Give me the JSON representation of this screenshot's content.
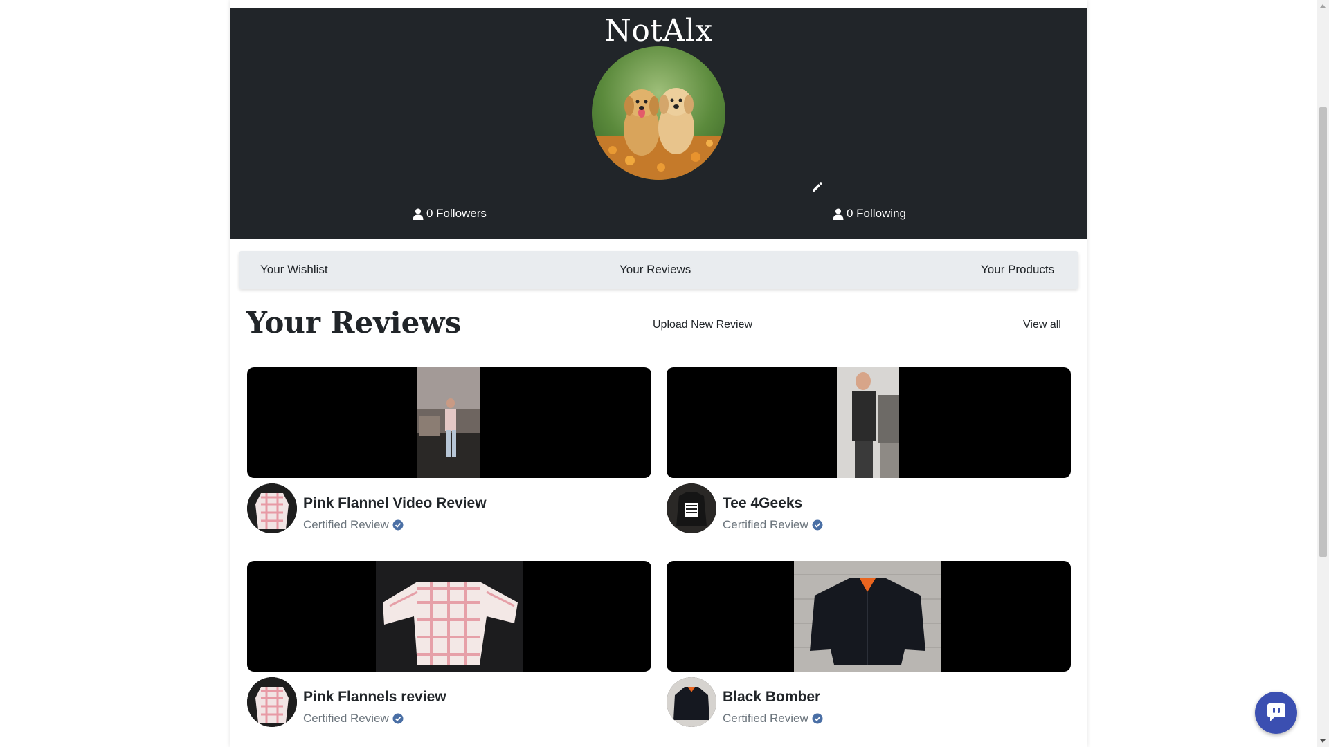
{
  "profile": {
    "username": "NotAlx",
    "followers_label": "0 Followers",
    "following_label": "0 Following"
  },
  "tabs": [
    {
      "label": "Your Wishlist"
    },
    {
      "label": "Your Reviews"
    },
    {
      "label": "Your Products"
    }
  ],
  "section": {
    "title": "Your Reviews",
    "upload_label": "Upload New Review",
    "view_all_label": "View all"
  },
  "reviews": [
    {
      "title": "Pink Flannel Video Review",
      "certified_label": "Certified Review"
    },
    {
      "title": "Tee 4Geeks",
      "certified_label": "Certified Review"
    },
    {
      "title": "Pink Flannels review",
      "certified_label": "Certified Review"
    },
    {
      "title": "Black Bomber",
      "certified_label": "Certified Review"
    }
  ],
  "colors": {
    "header_bg": "#212529",
    "tabs_bg": "#e9ecef",
    "certified_badge": "#4a6fa5",
    "chat_button": "#3b4fb1"
  },
  "icons": {
    "edit": "pencil-icon",
    "user": "user-icon",
    "verified": "check-circle-icon",
    "chat": "chat-icon"
  }
}
